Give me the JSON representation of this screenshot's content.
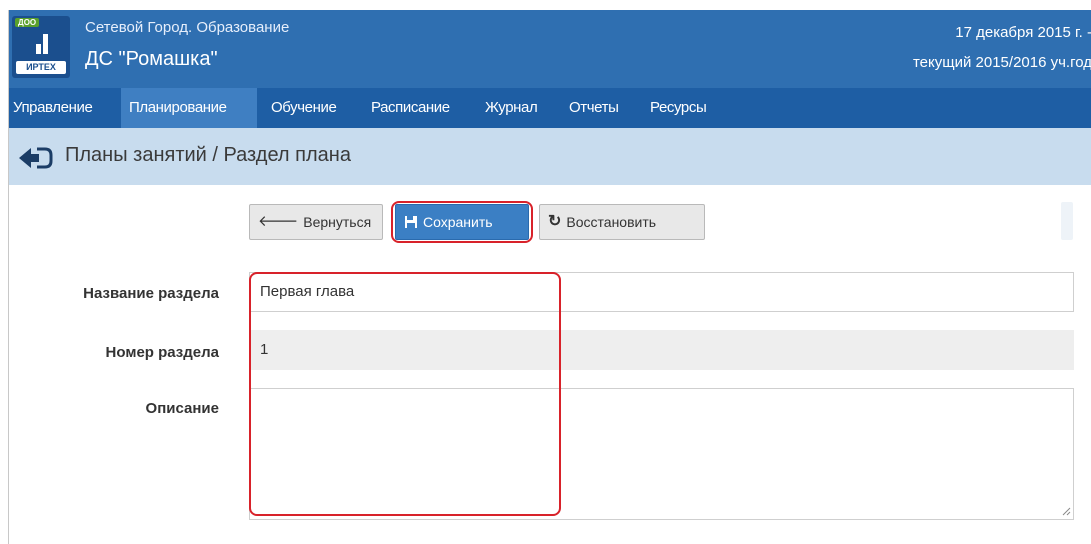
{
  "header": {
    "logo_badge": "ДОО",
    "logo_brand": "ИРТЕХ",
    "system_name": "Сетевой Город. Образование",
    "school_name": "ДС \"Ромашка\"",
    "date": "17 декабря 2015 г. -",
    "academic_year": "текущий 2015/2016 уч.год"
  },
  "menu": {
    "items": [
      {
        "label": "Управление",
        "active": false
      },
      {
        "label": "Планирование",
        "active": true
      },
      {
        "label": "Обучение",
        "active": false
      },
      {
        "label": "Расписание",
        "active": false
      },
      {
        "label": "Журнал",
        "active": false
      },
      {
        "label": "Отчеты",
        "active": false
      },
      {
        "label": "Ресурсы",
        "active": false
      }
    ]
  },
  "page": {
    "title": "Планы занятий / Раздел плана",
    "back_icon": "circle-arrow-left-icon"
  },
  "toolbar": {
    "back_label": "Вернуться",
    "save_label": "Сохранить",
    "restore_label": "Восстановить"
  },
  "form": {
    "section_name_label": "Название раздела",
    "section_name_value": "Первая глава",
    "section_number_label": "Номер раздела",
    "section_number_value": "1",
    "description_label": "Описание",
    "description_value": ""
  },
  "colors": {
    "header_bg": "#2f6fb1",
    "menu_bg": "#1e5ea4",
    "menu_active_bg": "#3f7fc2",
    "titlebar_bg": "#c8dcee",
    "primary_button": "#3b7fc4",
    "highlight": "#d8222a"
  }
}
